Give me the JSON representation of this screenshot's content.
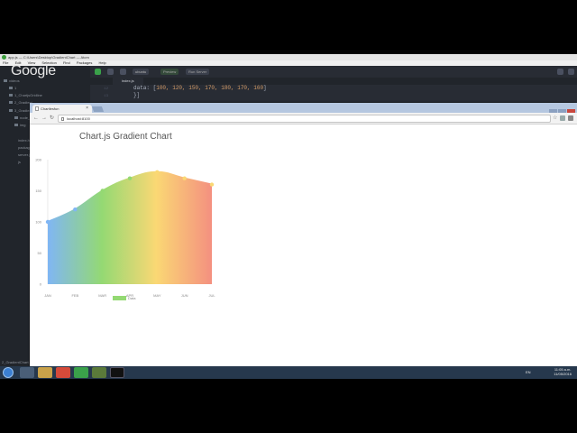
{
  "ide": {
    "window_title": "app.js — C:\\Users\\Desktop\\GradientChart — Atom",
    "menu": [
      "File",
      "Edit",
      "View",
      "Selection",
      "Find",
      "Packages",
      "Help"
    ],
    "logo_text": "Google",
    "toolbar": {
      "select_label": "ubuntu",
      "pill_1": "Preview",
      "pill_2": "Run Server"
    },
    "editor_tab": "index.js",
    "sidebar_items": [
      {
        "label": "videos"
      },
      {
        "label": "1"
      },
      {
        "label": "1_ChartjsGridline"
      },
      {
        "label": "2_Gradient"
      },
      {
        "label": "3_Gradient"
      },
      {
        "label": "node_modules"
      },
      {
        "label": "img"
      },
      {
        "label": "index.html"
      },
      {
        "label": "package.json"
      },
      {
        "label": "server.js"
      },
      {
        "label": "js"
      }
    ],
    "code": [
      {
        "ln": "12",
        "text": "data: [",
        "nums": "100, 120, 150, 170, 180, 170, 160",
        "end": "]"
      },
      {
        "ln": "13",
        "text": "}]",
        "nums": "",
        "end": ""
      }
    ],
    "status_left": "2_GradientChart"
  },
  "browser": {
    "tab_title": "Chartlesfun",
    "url": "localhost:8100"
  },
  "chart_data": {
    "type": "area",
    "title": "Chart.js Gradient Chart",
    "categories": [
      "JAN",
      "FEB",
      "MAR",
      "APR",
      "MAY",
      "JUN",
      "JUL"
    ],
    "series": [
      {
        "name": "Data",
        "values": [
          100,
          120,
          150,
          170,
          180,
          170,
          160
        ]
      }
    ],
    "y_ticks": [
      "0",
      "50",
      "100",
      "150",
      "200"
    ],
    "ylim": [
      0,
      200
    ],
    "gradient_colors": [
      "#80b6f4",
      "#94d973",
      "#fad874",
      "#f49080"
    ],
    "legend_position": "bottom",
    "grid": false
  },
  "taskbar": {
    "lang": "EN",
    "time": "11:05 a.m.",
    "date": "11/05/2016"
  }
}
